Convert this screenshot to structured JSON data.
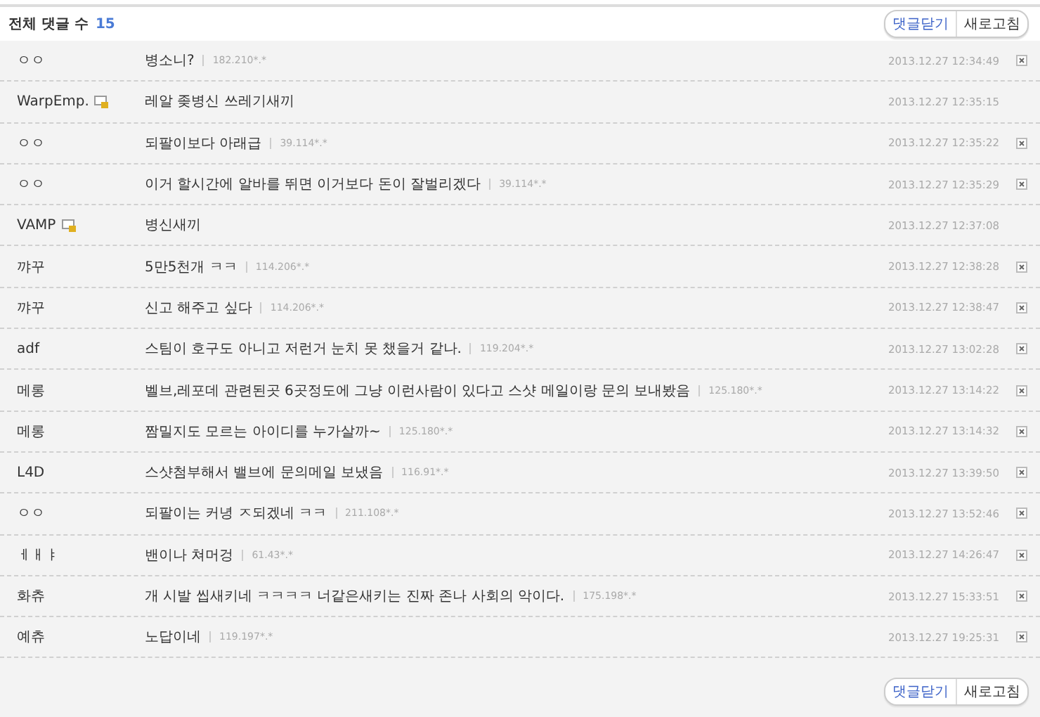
{
  "header": {
    "title": "전체 댓글 수",
    "count": "15",
    "buttons": [
      {
        "label": "댓글닫기",
        "kind": "close"
      },
      {
        "label": "새로고침",
        "kind": "refresh"
      }
    ]
  },
  "comments": [
    {
      "author": "ㅇㅇ",
      "member": false,
      "text": "병소니?",
      "ip": "182.210*.*",
      "time": "2013.12.27 12:34:49",
      "deletable": true
    },
    {
      "author": "WarpEmp.",
      "member": true,
      "text": "레알 좆병신 쓰레기새끼",
      "time": "2013.12.27 12:35:15",
      "deletable": false
    },
    {
      "author": "ㅇㅇ",
      "member": false,
      "text": "되팔이보다 아래급",
      "ip": "39.114*.*",
      "time": "2013.12.27 12:35:22",
      "deletable": true
    },
    {
      "author": "ㅇㅇ",
      "member": false,
      "text": "이거 할시간에 알바를 뛰면 이거보다 돈이 잘벌리겠다",
      "ip": "39.114*.*",
      "time": "2013.12.27 12:35:29",
      "deletable": true
    },
    {
      "author": "VAMP",
      "member": true,
      "text": "병신새끼",
      "time": "2013.12.27 12:37:08",
      "deletable": false
    },
    {
      "author": "꺄꾸",
      "member": false,
      "text": "5만5천개 ㅋㅋ",
      "ip": "114.206*.*",
      "time": "2013.12.27 12:38:28",
      "deletable": true
    },
    {
      "author": "꺄꾸",
      "member": false,
      "text": "신고 해주고 싶다",
      "ip": "114.206*.*",
      "time": "2013.12.27 12:38:47",
      "deletable": true
    },
    {
      "author": "adf",
      "member": false,
      "text": "스팀이 호구도 아니고 저런거 눈치 못 챘을거 같나.",
      "ip": "119.204*.*",
      "time": "2013.12.27 13:02:28",
      "deletable": true
    },
    {
      "author": "메롱",
      "member": false,
      "text": "벨브,레포데 관련된곳 6곳정도에 그냥 이런사람이 있다고 스샷 메일이랑 문의 보내봤음",
      "ip": "125.180*.*",
      "time": "2013.12.27 13:14:22",
      "deletable": true
    },
    {
      "author": "메롱",
      "member": false,
      "text": "짬밀지도 모르는 아이디를 누가살까~",
      "ip": "125.180*.*",
      "time": "2013.12.27 13:14:32",
      "deletable": true
    },
    {
      "author": "L4D",
      "member": false,
      "text": "스샷첨부해서 밸브에 문의메일 보냈음",
      "ip": "116.91*.*",
      "time": "2013.12.27 13:39:50",
      "deletable": true
    },
    {
      "author": "ㅇㅇ",
      "member": false,
      "text": "되팔이는 커녕 ㅈ되겠네 ㅋㅋ",
      "ip": "211.108*.*",
      "time": "2013.12.27 13:52:46",
      "deletable": true
    },
    {
      "author": "ㅔㅐㅑ",
      "member": false,
      "text": "밴이나 쳐머겅",
      "ip": "61.43*.*",
      "time": "2013.12.27 14:26:47",
      "deletable": true
    },
    {
      "author": "화츄",
      "member": false,
      "text": "개 시발 씹새키네 ㅋㅋㅋㅋ 너같은새키는 진짜 존나 사회의 악이다.",
      "ip": "175.198*.*",
      "time": "2013.12.27 15:33:51",
      "deletable": true
    },
    {
      "author": "예츄",
      "member": false,
      "text": "노답이네",
      "ip": "119.197*.*",
      "time": "2013.12.27 19:25:31",
      "deletable": true
    }
  ],
  "footer": {
    "buttons": [
      {
        "label": "댓글닫기",
        "kind": "close"
      },
      {
        "label": "새로고침",
        "kind": "refresh"
      }
    ]
  }
}
